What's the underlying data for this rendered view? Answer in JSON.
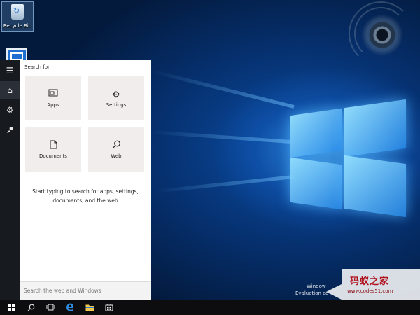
{
  "desktop": {
    "recycle_bin_label": "Recycle Bin",
    "watermark": {
      "eval_line1": "Window",
      "eval_line2": "Evaluation co",
      "site_title": "码蚁之家",
      "site_url": "www.codes51.com"
    }
  },
  "start_panel": {
    "heading": "Search for",
    "tiles": [
      {
        "label": "Apps",
        "icon": "apps-icon"
      },
      {
        "label": "Settings",
        "icon": "settings-gear-icon"
      },
      {
        "label": "Documents",
        "icon": "document-icon"
      },
      {
        "label": "Web",
        "icon": "web-search-icon"
      }
    ],
    "hint": "Start typing to search for apps, settings, documents, and the web",
    "search_placeholder": "Search the web and Windows"
  },
  "rail": {
    "items": [
      {
        "icon": "hamburger-menu-icon"
      },
      {
        "icon": "home-icon"
      },
      {
        "icon": "settings-gear-icon"
      },
      {
        "icon": "feedback-icon"
      }
    ]
  },
  "taskbar": {
    "items": [
      {
        "icon": "windows-start-icon"
      },
      {
        "icon": "search-icon"
      },
      {
        "icon": "task-view-icon"
      },
      {
        "icon": "edge-browser-icon"
      },
      {
        "icon": "file-explorer-icon"
      },
      {
        "icon": "store-icon"
      }
    ]
  },
  "colors": {
    "accent": "#1e6fd0",
    "panel_bg": "#ffffff",
    "tile_bg": "#f2eded",
    "rail_bg": "#171a1f",
    "taskbar_bg": "#0d0d0f"
  }
}
